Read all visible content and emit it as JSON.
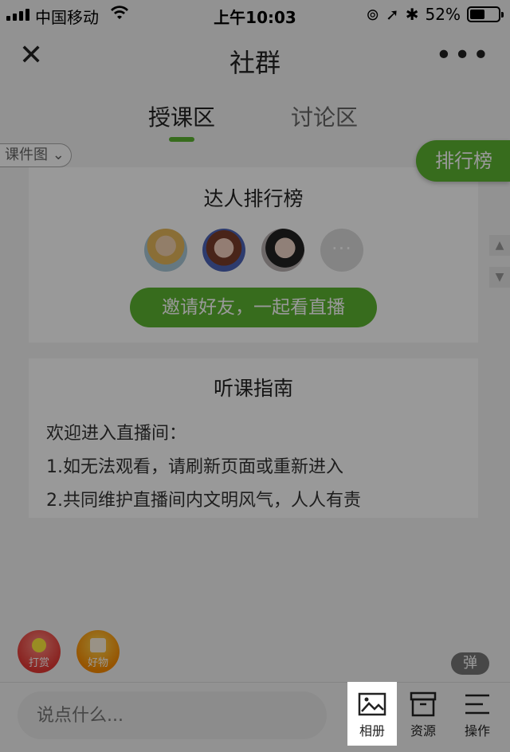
{
  "status_bar": {
    "carrier": "中国移动",
    "time": "上午10:03",
    "battery": "52%",
    "battery_level": 0.52
  },
  "nav": {
    "close_icon": "close-icon",
    "title": "社群",
    "more_icon": "more-icon"
  },
  "tabs": [
    {
      "label": "授课区",
      "active": true
    },
    {
      "label": "讨论区",
      "active": false
    }
  ],
  "courseware_label": "课件图",
  "ranking_button": "排行榜",
  "rank_card": {
    "title": "达人排行榜",
    "more": "···",
    "invite_button": "邀请好友，一起看直播"
  },
  "guide_card": {
    "title": "听课指南",
    "lines": [
      "欢迎进入直播间：",
      "1.如无法观看，请刷新页面或重新进入",
      "2.共同维护直播间内文明风气，人人有责"
    ]
  },
  "float": {
    "tip_label": "打赏",
    "gift_label": "好物",
    "danmu_label": "弹"
  },
  "bottom": {
    "input_placeholder": "说点什么...",
    "album_label": "相册",
    "resource_label": "资源",
    "ops_label": "操作"
  },
  "colors": {
    "accent": "#5cb531",
    "overlay": "rgba(0,0,0,0.40)"
  }
}
